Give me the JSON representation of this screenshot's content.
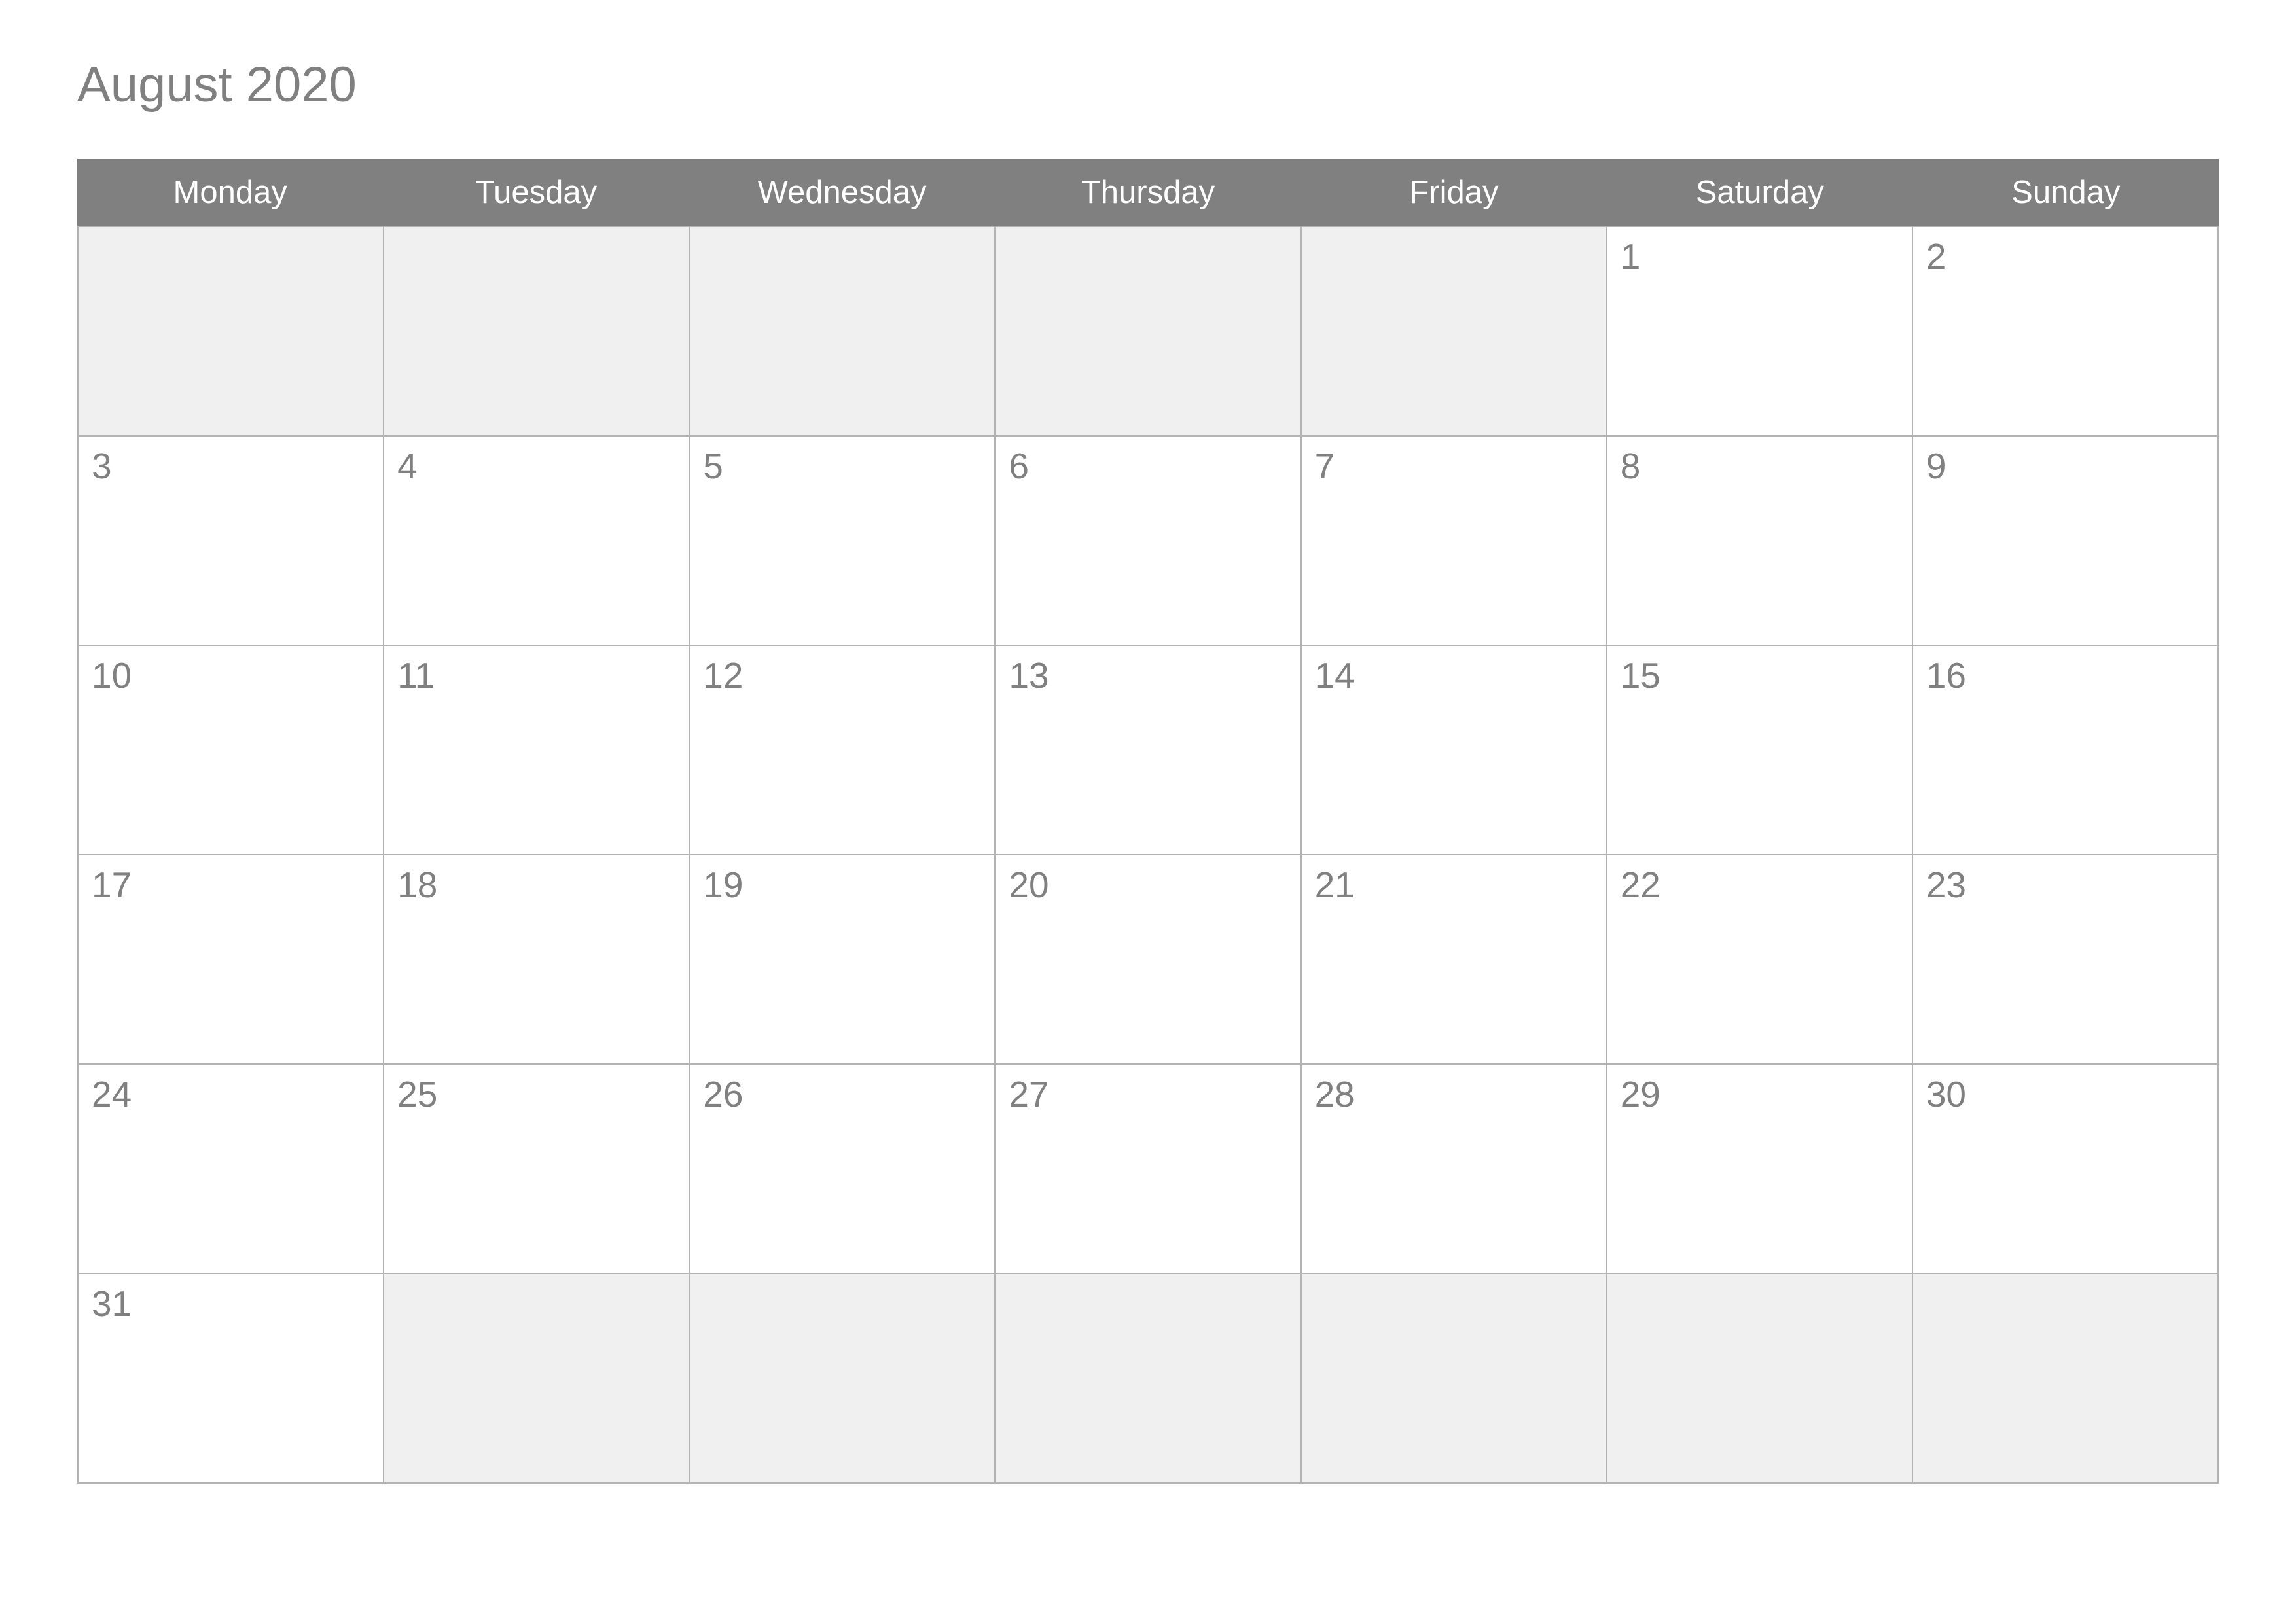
{
  "calendar": {
    "title": "August 2020",
    "month": "August",
    "year": "2020",
    "weekdays": [
      "Monday",
      "Tuesday",
      "Wednesday",
      "Thursday",
      "Friday",
      "Saturday",
      "Sunday"
    ],
    "weeks": [
      [
        "",
        "",
        "",
        "",
        "",
        "1",
        "2"
      ],
      [
        "3",
        "4",
        "5",
        "6",
        "7",
        "8",
        "9"
      ],
      [
        "10",
        "11",
        "12",
        "13",
        "14",
        "15",
        "16"
      ],
      [
        "17",
        "18",
        "19",
        "20",
        "21",
        "22",
        "23"
      ],
      [
        "24",
        "25",
        "26",
        "27",
        "28",
        "29",
        "30"
      ],
      [
        "31",
        "",
        "",
        "",
        "",
        "",
        ""
      ]
    ],
    "colors": {
      "header_background": "#808080",
      "header_text": "#ffffff",
      "empty_cell_background": "#f0f0f0",
      "day_cell_background": "#ffffff",
      "grid_border": "#b3b3b3",
      "day_number_text": "#808080",
      "title_text": "#808080",
      "page_background": "#ffffff"
    }
  }
}
